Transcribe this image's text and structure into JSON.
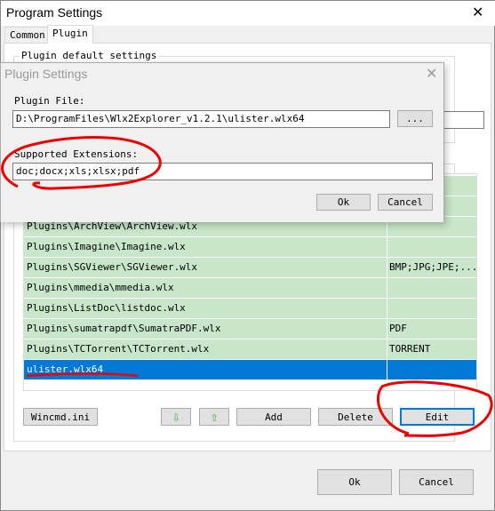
{
  "window": {
    "title": "Program Settings",
    "close_icon": "close-icon"
  },
  "tabs": [
    {
      "label": "Common"
    },
    {
      "label": "Plugin",
      "active": true
    }
  ],
  "group": {
    "title": "Plugin default settings"
  },
  "plugins": [
    {
      "file": "",
      "ext": ""
    },
    {
      "file": "",
      "ext": ""
    },
    {
      "file": "Plugins\\ArchView\\ArchView.wlx",
      "ext": ""
    },
    {
      "file": "Plugins\\Imagine\\Imagine.wlx",
      "ext": ""
    },
    {
      "file": "Plugins\\SGViewer\\SGViewer.wlx",
      "ext": "BMP;JPG;JPE;..."
    },
    {
      "file": "Plugins\\mmedia\\mmedia.wlx",
      "ext": ""
    },
    {
      "file": "Plugins\\ListDoc\\listdoc.wlx",
      "ext": ""
    },
    {
      "file": "Plugins\\sumatrapdf\\SumatraPDF.wlx",
      "ext": "PDF"
    },
    {
      "file": "Plugins\\TCTorrent\\TCTorrent.wlx",
      "ext": "TORRENT"
    },
    {
      "file": "ulister.wlx64",
      "ext": "",
      "selected": true
    }
  ],
  "buttons": {
    "wincmd": "Wincmd.ini",
    "down_icon": "arrow-down-icon",
    "up_icon": "arrow-up-icon",
    "add": "Add",
    "delete": "Delete",
    "edit": "Edit",
    "ok": "Ok",
    "cancel": "Cancel"
  },
  "dialog": {
    "title": "Plugin Settings",
    "plugin_file_label": "Plugin File:",
    "plugin_file_value": "D:\\ProgramFiles\\Wlx2Explorer_v1.2.1\\ulister.wlx64",
    "browse": "...",
    "ext_label": "Supported Extensions:",
    "ext_value": "doc;docx;xls;xlsx;pdf",
    "ok": "Ok",
    "cancel": "Cancel"
  },
  "colors": {
    "row": "#c8e6c9",
    "selected": "#0078d7",
    "annotation": "#e00000"
  }
}
